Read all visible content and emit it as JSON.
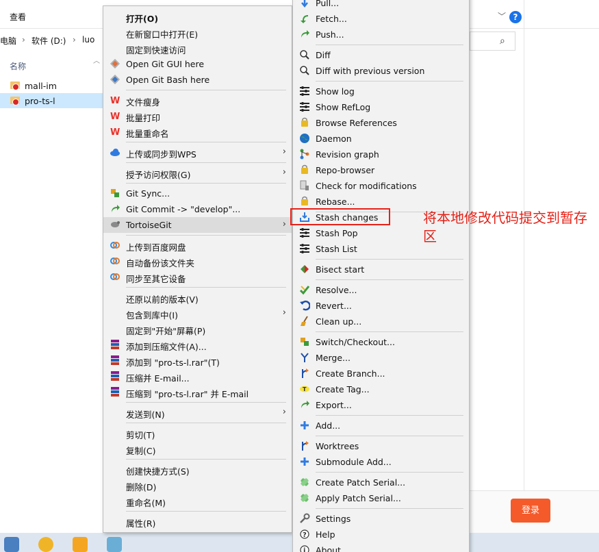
{
  "explorer": {
    "ribbon_view": "查看",
    "help_label": "?",
    "crumbs": [
      "电脑",
      "软件 (D:)",
      "luo"
    ],
    "column_name": "名称",
    "files": [
      {
        "name": "mall-im",
        "selected": false
      },
      {
        "name": "pro-ts-l",
        "selected": true
      }
    ],
    "login_label": "登录"
  },
  "main_menu": {
    "open": "打开(O)",
    "open_new_window": "在新窗口中打开(E)",
    "pin_quick": "固定到快速访问",
    "git_gui": "Open Git GUI here",
    "git_bash": "Open Git Bash here",
    "file_slim": "文件瘦身",
    "batch_print": "批量打印",
    "batch_rename": "批量重命名",
    "upload_wps": "上传或同步到WPS",
    "grant_access": "授予访问权限(G)",
    "git_sync": "Git Sync...",
    "git_commit": "Git Commit -> \"develop\"...",
    "tortoisegit": "TortoiseGit",
    "upload_baidu": "上传到百度网盘",
    "auto_backup": "自动备份该文件夹",
    "sync_devices": "同步至其它设备",
    "restore_prev": "还原以前的版本(V)",
    "include_library": "包含到库中(I)",
    "pin_start": "固定到\"开始\"屏幕(P)",
    "add_archive": "添加到压缩文件(A)...",
    "add_rar": "添加到 \"pro-ts-l.rar\"(T)",
    "compress_email": "压缩并 E-mail...",
    "compress_rar_email": "压缩到 \"pro-ts-l.rar\" 并 E-mail",
    "send_to": "发送到(N)",
    "cut": "剪切(T)",
    "copy": "复制(C)",
    "create_shortcut": "创建快捷方式(S)",
    "delete": "删除(D)",
    "rename": "重命名(M)",
    "properties": "属性(R)"
  },
  "sub_menu": {
    "pull": "Pull...",
    "fetch": "Fetch...",
    "push": "Push...",
    "diff": "Diff",
    "diff_prev": "Diff with previous version",
    "show_log": "Show log",
    "show_reflog": "Show RefLog",
    "browse_refs": "Browse References",
    "daemon": "Daemon",
    "revision_graph": "Revision graph",
    "repo_browser": "Repo-browser",
    "check_mod": "Check for modifications",
    "rebase": "Rebase...",
    "stash_changes": "Stash changes",
    "stash_pop": "Stash Pop",
    "stash_list": "Stash List",
    "bisect_start": "Bisect start",
    "resolve": "Resolve...",
    "revert": "Revert...",
    "clean_up": "Clean up...",
    "switch_checkout": "Switch/Checkout...",
    "merge": "Merge...",
    "create_branch": "Create Branch...",
    "create_tag": "Create Tag...",
    "export": "Export...",
    "add": "Add...",
    "worktrees": "Worktrees",
    "submodule_add": "Submodule Add...",
    "create_patch": "Create Patch Serial...",
    "apply_patch": "Apply Patch Serial...",
    "settings": "Settings",
    "help": "Help",
    "about": "About"
  },
  "annotation": {
    "text": "将本地修改代码提交到暂存区"
  },
  "colors": {
    "annotation": "#e62117",
    "menu_bg": "#f2f2f2",
    "selected_row": "#cce8ff",
    "login_btn": "#f45a2a"
  }
}
